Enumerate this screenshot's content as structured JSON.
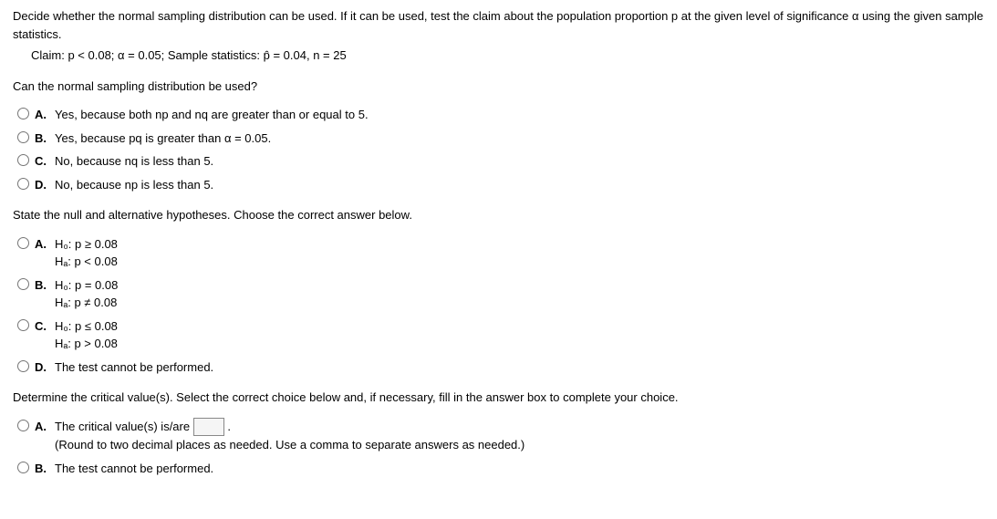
{
  "intro": "Decide whether the normal sampling distribution can be used. If it can be used, test the claim about the population proportion p at the given level of significance α using the given sample statistics.",
  "claim": "Claim: p < 0.08; α = 0.05; Sample statistics: p̂ = 0.04, n = 25",
  "q1": {
    "prompt": "Can the normal sampling distribution be used?",
    "options": {
      "A": "Yes, because both np and nq are greater than or equal to 5.",
      "B": "Yes, because pq is greater than α = 0.05.",
      "C": "No, because nq is less than 5.",
      "D": "No, because np is less than 5."
    }
  },
  "q2": {
    "prompt": "State the null and alternative hypotheses. Choose the correct answer below.",
    "options": {
      "A": {
        "line1": "H₀: p ≥ 0.08",
        "line2": "Hₐ: p < 0.08"
      },
      "B": {
        "line1": "H₀: p = 0.08",
        "line2": "Hₐ: p ≠ 0.08"
      },
      "C": {
        "line1": "H₀: p ≤ 0.08",
        "line2": "Hₐ: p > 0.08"
      },
      "D": "The test cannot be performed."
    }
  },
  "q3": {
    "prompt": "Determine the critical value(s). Select the correct choice below and, if necessary, fill in the answer box to complete your choice.",
    "options": {
      "A": {
        "text": "The critical value(s) is/are ",
        "note": "(Round to two decimal places as needed. Use a comma to separate answers as needed.)"
      },
      "B": "The test cannot be performed."
    }
  }
}
